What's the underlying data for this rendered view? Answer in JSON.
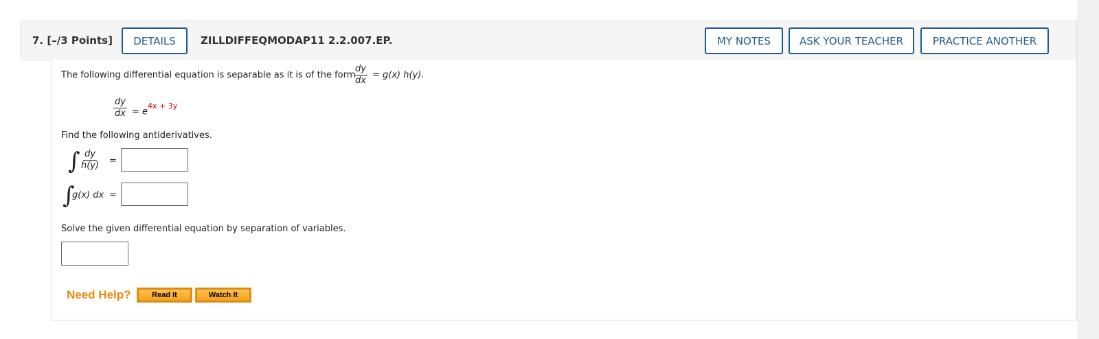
{
  "question": {
    "number": "7.",
    "points": "[–/3 Points]",
    "details_label": "DETAILS",
    "code": "ZILLDIFFEQMODAP11 2.2.007.EP.",
    "my_notes_label": "MY NOTES",
    "ask_teacher_label": "ASK YOUR TEACHER",
    "practice_label": "PRACTICE ANOTHER"
  },
  "body": {
    "intro": "The following differential equation is separable as it is of the form",
    "form_num": "dy",
    "form_den": "dx",
    "form_rhs": "= g(x) h(y).",
    "eq_num": "dy",
    "eq_den": "dx",
    "eq_equals": "= e",
    "eq_exponent": "4x + 3y",
    "find_text": "Find the following antiderivatives.",
    "int1_num": "dy",
    "int1_den": "h(y)",
    "int1_equals": "=",
    "int2_expr": "g(x) dx",
    "int2_equals": "=",
    "solve_text": "Solve the given differential equation by separation of variables.",
    "answer1_value": "",
    "answer2_value": "",
    "answer3_value": ""
  },
  "help": {
    "label": "Need Help?",
    "read_it": "Read It",
    "watch_it": "Watch It"
  },
  "colors": {
    "accent_blue": "#1f5a8e",
    "help_orange": "#e8890c",
    "exponent_red": "#cc0000"
  }
}
